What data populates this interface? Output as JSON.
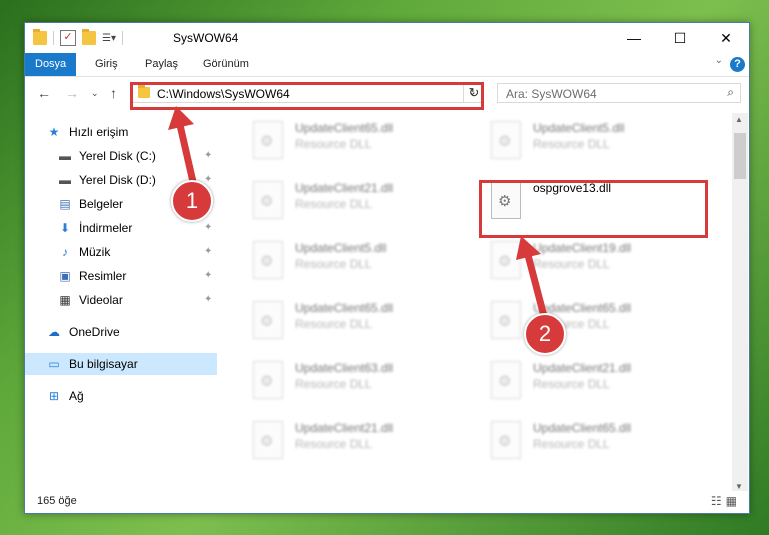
{
  "window": {
    "title": "SysWOW64"
  },
  "ribbon": {
    "tabs": [
      "Dosya",
      "Giriş",
      "Paylaş",
      "Görünüm"
    ],
    "help_label": "?"
  },
  "nav": {
    "address_path": "C:\\Windows\\SysWOW64",
    "search_placeholder": "Ara: SysWOW64"
  },
  "sidebar": {
    "items": [
      {
        "label": "Hızlı erişim",
        "icon": "star-icon"
      },
      {
        "label": "Yerel Disk (C:)",
        "icon": "drive-icon"
      },
      {
        "label": "Yerel Disk (D:)",
        "icon": "drive-icon"
      },
      {
        "label": "Belgeler",
        "icon": "document-icon"
      },
      {
        "label": "İndirmeler",
        "icon": "download-icon"
      },
      {
        "label": "Müzik",
        "icon": "music-icon"
      },
      {
        "label": "Resimler",
        "icon": "picture-icon"
      },
      {
        "label": "Videolar",
        "icon": "video-icon"
      },
      {
        "label": "OneDrive",
        "icon": "cloud-icon"
      },
      {
        "label": "Bu bilgisayar",
        "icon": "computer-icon"
      },
      {
        "label": "Ağ",
        "icon": "network-icon"
      }
    ]
  },
  "files": {
    "left": [
      {
        "name": "UpdateClient65.dll",
        "type": "Resource DLL"
      },
      {
        "name": "UpdateClient21.dll",
        "type": "Resource DLL"
      },
      {
        "name": "UpdateClient5.dll",
        "type": "Resource DLL"
      },
      {
        "name": "UpdateClient65.dll",
        "type": "Resource DLL"
      },
      {
        "name": "UpdateClient63.dll",
        "type": "Resource DLL"
      },
      {
        "name": "UpdateClient21.dll",
        "type": "Resource DLL"
      }
    ],
    "right": [
      {
        "name": "UpdateClient5.dll",
        "type": "Resource DLL"
      },
      {
        "name": "ospgrove13.dll",
        "type": ""
      },
      {
        "name": "UpdateClient19.dll",
        "type": "Resource DLL"
      },
      {
        "name": "UpdateClient65.dll",
        "type": "Resource DLL"
      },
      {
        "name": "UpdateClient21.dll",
        "type": "Resource DLL"
      },
      {
        "name": "UpdateClient65.dll",
        "type": "Resource DLL"
      }
    ]
  },
  "status": {
    "item_count": "165 öğe"
  },
  "annotations": {
    "step1": "1",
    "step2": "2"
  },
  "colors": {
    "accent": "#1979ca",
    "highlight_red": "#d63a3a"
  }
}
